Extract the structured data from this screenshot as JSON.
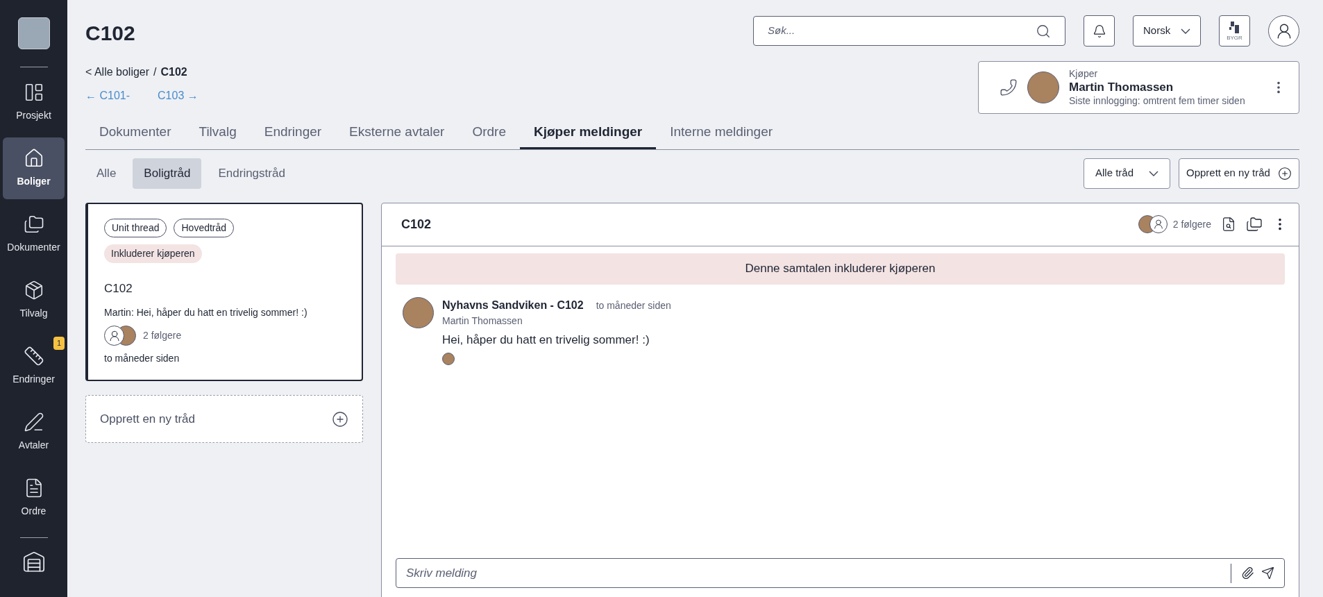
{
  "sidebar": {
    "items": [
      {
        "label": "Prosjekt",
        "selected": false
      },
      {
        "label": "Boliger",
        "selected": true
      },
      {
        "label": "Dokumenter",
        "selected": false
      },
      {
        "label": "Tilvalg",
        "selected": false
      },
      {
        "label": "Endringer",
        "selected": false,
        "badge": "1"
      },
      {
        "label": "Avtaler",
        "selected": false
      },
      {
        "label": "Ordre",
        "selected": false
      }
    ]
  },
  "page_title": "C102",
  "breadcrumb": {
    "back": "< Alle boliger",
    "separator": "/",
    "current": "C102"
  },
  "unit_nav": {
    "previous": "← C101-",
    "next": "C103 →"
  },
  "header": {
    "search": {
      "placeholder": "Søk..."
    },
    "language": "Norsk",
    "logo_text": "BYGR"
  },
  "buyer_card": {
    "role": "Kjøper",
    "name": "Martin Thomassen",
    "last_login": "Siste innlogging: omtrent fem timer siden"
  },
  "tabs": [
    {
      "label": "Dokumenter",
      "selected": false
    },
    {
      "label": "Tilvalg",
      "selected": false
    },
    {
      "label": "Endringer",
      "selected": false
    },
    {
      "label": "Eksterne avtaler",
      "selected": false
    },
    {
      "label": "Ordre",
      "selected": false
    },
    {
      "label": "Kjøper meldinger",
      "selected": true
    },
    {
      "label": "Interne meldinger",
      "selected": false
    }
  ],
  "subtabs": [
    {
      "label": "Alle",
      "selected": false
    },
    {
      "label": "Boligtråd",
      "selected": true
    },
    {
      "label": "Endringstråd",
      "selected": false
    }
  ],
  "thread_filter": "Alle tråd",
  "new_thread_button": "Opprett en ny tråd",
  "threads": [
    {
      "tags": [
        "Unit thread",
        "Hovedtråd"
      ],
      "buyer_tag": "Inkluderer kjøperen",
      "title": "C102",
      "preview": "Martin: Hei, håper du hatt en trivelig sommer! :)",
      "followers": "2 følgere",
      "time": "to måneder siden",
      "selected": true
    }
  ],
  "new_thread_card": "Opprett en ny tråd",
  "conversation": {
    "title": "C102",
    "followers": "2 følgere",
    "banner": "Denne samtalen inkluderer kjøperen",
    "messages": [
      {
        "sender": "Nyhavns Sandviken - C102",
        "time": "to måneder siden",
        "author": "Martin Thomassen",
        "text": "Hei, håper du hatt en trivelig sommer! :)"
      }
    ],
    "composer": {
      "placeholder": "Skriv melding"
    }
  }
}
